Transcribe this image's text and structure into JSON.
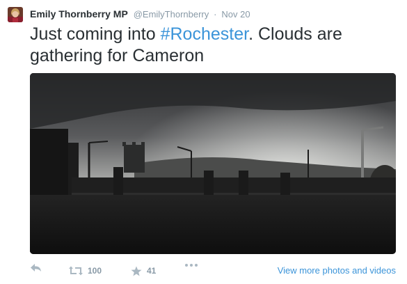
{
  "tweet": {
    "author_name": "Emily Thornberry MP",
    "author_handle": "@EmilyThornberry",
    "separator": "·",
    "timestamp": "Nov 20",
    "text_prefix": "Just coming into ",
    "hashtag": "#Rochester",
    "text_suffix": ". Clouds are gathering for Cameron"
  },
  "media": {
    "description_icon": "photo"
  },
  "actions": {
    "reply_icon": "reply-icon",
    "retweet_icon": "retweet-icon",
    "retweet_count": "100",
    "favorite_icon": "star-icon",
    "favorite_count": "41",
    "more_icon": "more-dots-icon",
    "view_more_label": "View more photos and videos"
  },
  "colors": {
    "text": "#292f33",
    "muted": "#8899a6",
    "link": "#3b94d9"
  }
}
